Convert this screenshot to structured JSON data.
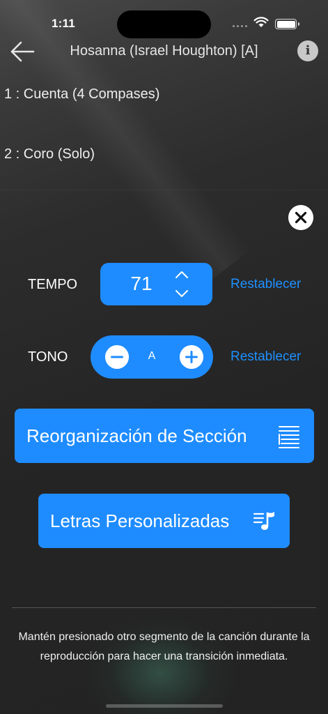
{
  "status_bar": {
    "time": "1:11"
  },
  "nav": {
    "title": "Hosanna (Israel Houghton) [A]"
  },
  "sections": [
    {
      "label": "1 : Cuenta (4 Compases)"
    },
    {
      "label": "2 : Coro (Solo)"
    }
  ],
  "tempo": {
    "label": "TEMPO",
    "value": "71",
    "reset_label": "Restablecer"
  },
  "key": {
    "label": "TONO",
    "value": "A",
    "reset_label": "Restablecer"
  },
  "buttons": {
    "section_reorder": "Reorganización de Sección",
    "custom_lyrics": "Letras Personalizadas"
  },
  "hint": "Mantén presionado otro segmento de la canción durante la reproducción para hacer una transición inmediata.",
  "colors": {
    "accent": "#1e8cff",
    "link": "#1e90ff",
    "background": "#242424"
  },
  "icons": [
    "back-arrow-icon",
    "info-icon",
    "close-icon",
    "chevron-up-icon",
    "chevron-down-icon",
    "minus-icon",
    "plus-icon",
    "list-icon",
    "music-list-icon"
  ]
}
